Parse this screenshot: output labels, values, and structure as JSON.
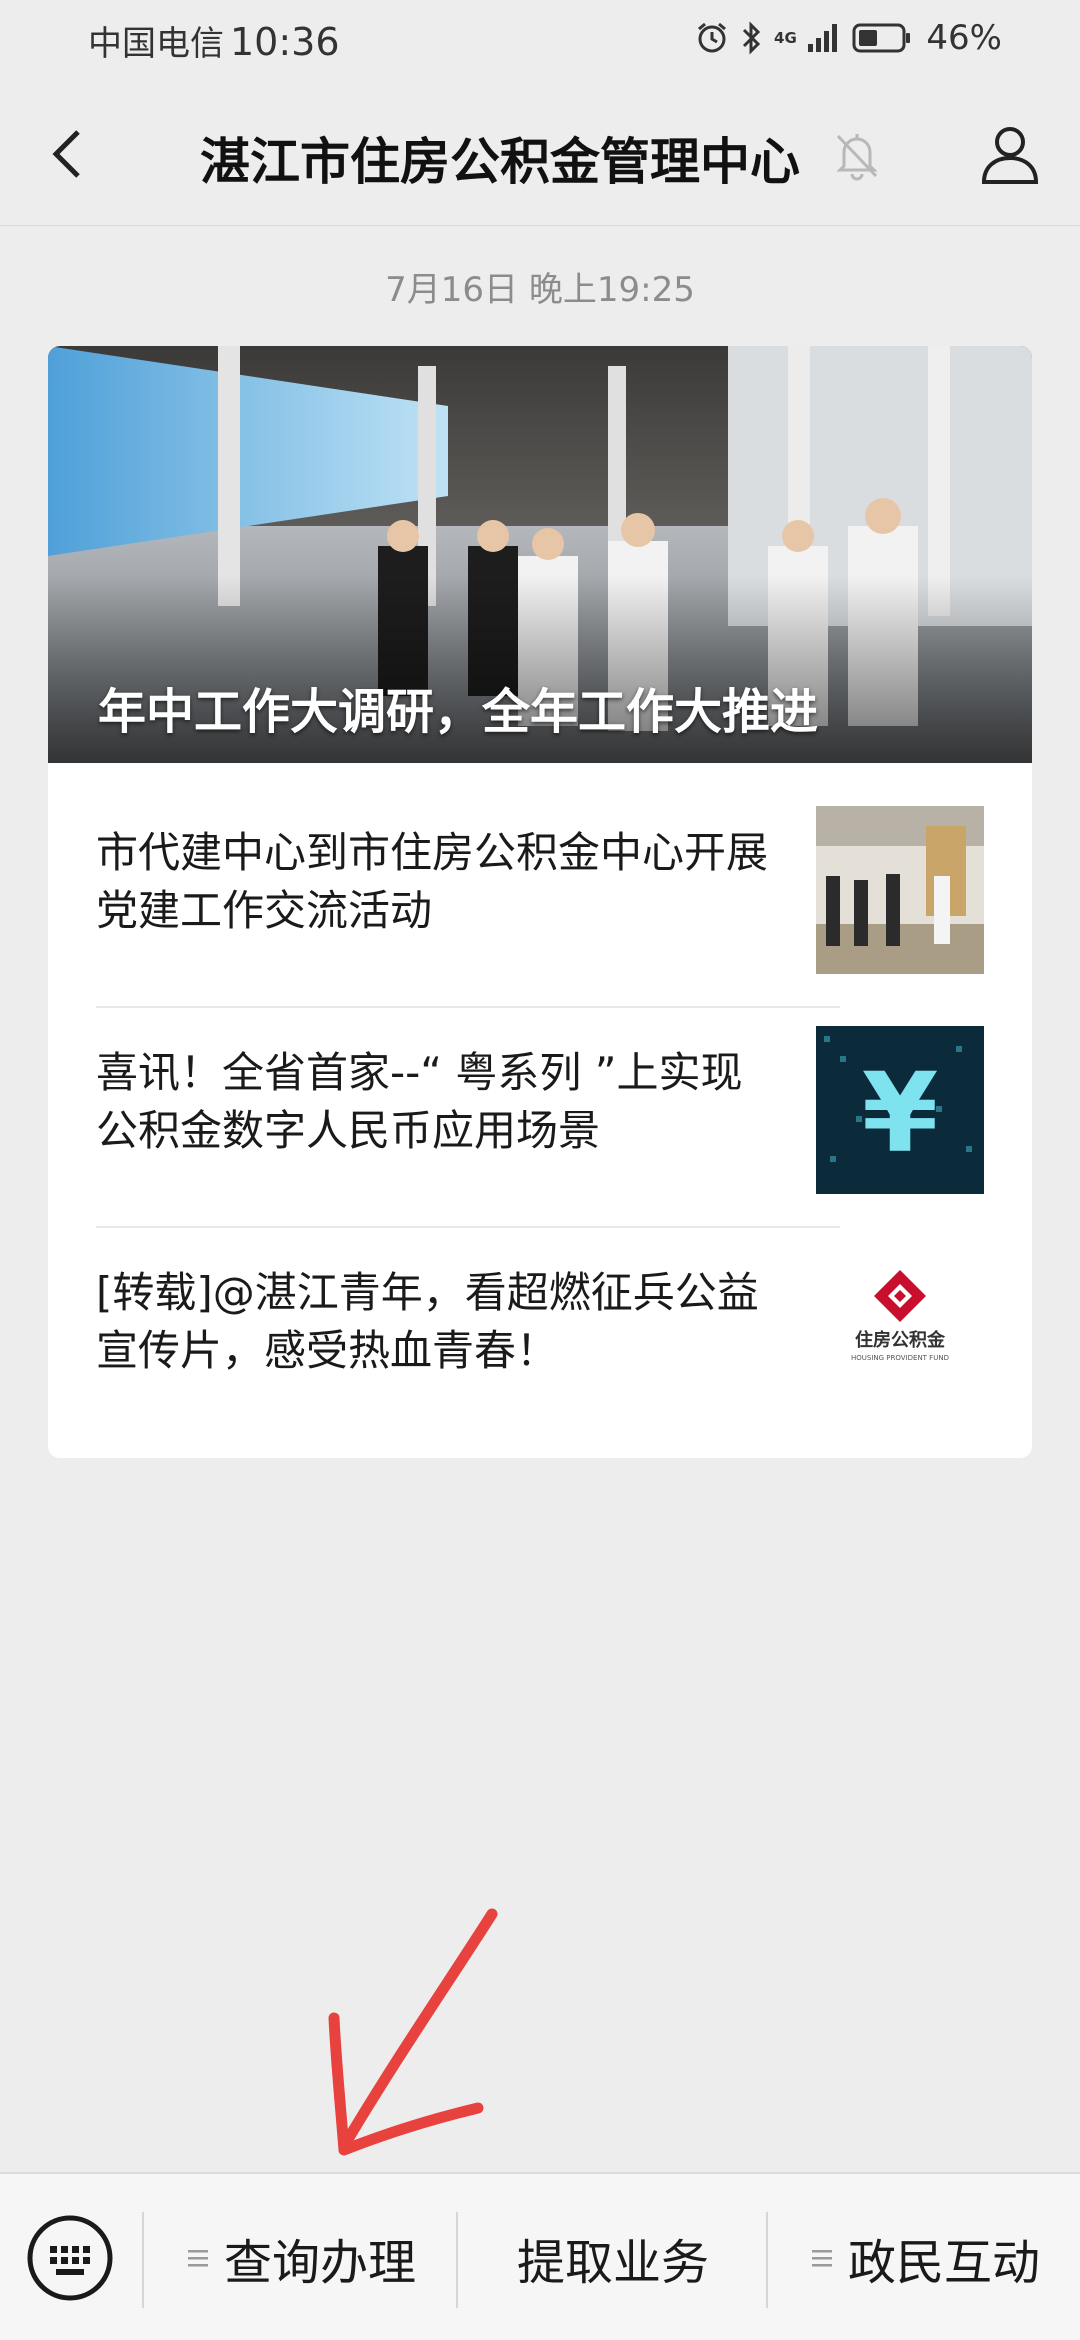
{
  "status_bar": {
    "carrier": "中国电信",
    "time": "10:36",
    "network": "4G",
    "battery_percent": "46%",
    "battery_level": 0.46,
    "icons": [
      "alarm-icon",
      "bluetooth-icon",
      "signal-icon",
      "battery-icon"
    ]
  },
  "nav": {
    "title": "湛江市住房公积金管理中心",
    "back_icon": "chevron-left-icon",
    "mute_icon": "bell-off-icon",
    "profile_icon": "person-icon"
  },
  "timestamp": "7月16日 晚上19:25",
  "cover": {
    "title": "年中工作大调研，全年工作大推进"
  },
  "articles": [
    {
      "title": "市代建中心到市住房公积金中心开展党建工作交流活动"
    },
    {
      "title": "喜讯！全省首家--“ 粤系列 ”上实现公积金数字人民币应用场景"
    },
    {
      "title": "[转载]@湛江青年，看超燃征兵公益宣传片，感受热血青春！",
      "thumb_text": "住房公积金",
      "thumb_subtext": "HOUSING PROVIDENT FUND"
    }
  ],
  "bottom_menu": {
    "keyboard_icon": "keyboard-icon",
    "items": [
      {
        "label": "查询办理",
        "has_submenu": true
      },
      {
        "label": "提取业务",
        "has_submenu": false
      },
      {
        "label": "政民互动",
        "has_submenu": true
      }
    ]
  },
  "colors": {
    "background": "#ededed",
    "card": "#ffffff",
    "arrow": "#e8423f",
    "logo_red": "#c8102e"
  }
}
